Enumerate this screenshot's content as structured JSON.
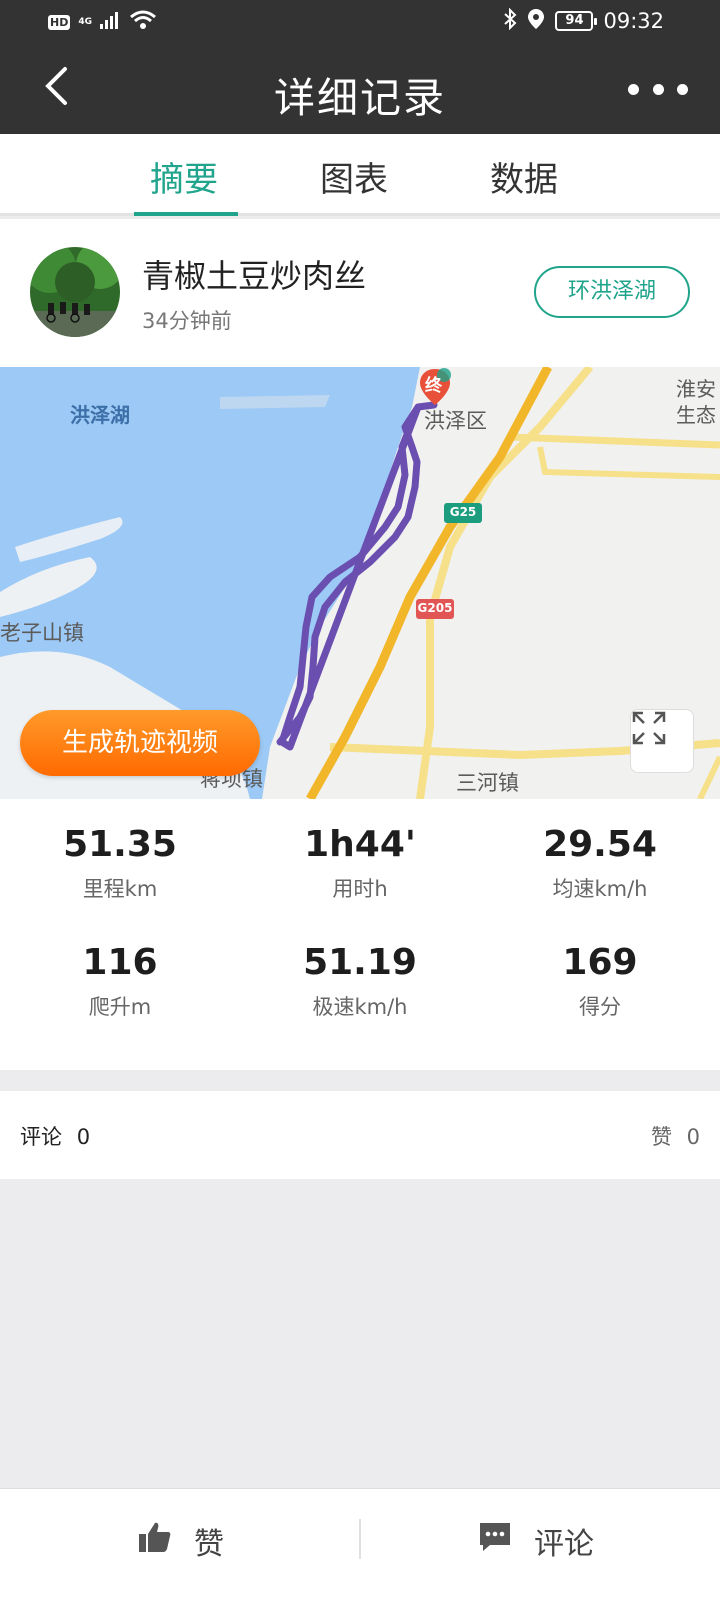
{
  "status_bar": {
    "hd": "HD",
    "network": "4G",
    "battery": "94",
    "time": "09:32"
  },
  "header": {
    "title": "详细记录"
  },
  "tabs": [
    {
      "label": "摘要",
      "active": true
    },
    {
      "label": "图表",
      "active": false
    },
    {
      "label": "数据",
      "active": false
    }
  ],
  "user": {
    "name": "青椒土豆炒肉丝",
    "time_ago": "34分钟前",
    "route_tag": "环洪泽湖"
  },
  "map": {
    "labels": {
      "lake": "洪泽湖",
      "district": "洪泽区",
      "town_left": "老子山镇",
      "town_bottom": "蒋坝镇",
      "town_bottom_right": "三河镇",
      "corner_1": "淮安",
      "corner_2": "生态"
    },
    "end_marker": "终",
    "roads": [
      "G25",
      "G205"
    ],
    "generate_video_label": "生成轨迹视频"
  },
  "stats": [
    {
      "value": "51.35",
      "label": "里程km"
    },
    {
      "value": "1h44'",
      "label": "用时h"
    },
    {
      "value": "29.54",
      "label": "均速km/h"
    },
    {
      "value": "116",
      "label": "爬升m"
    },
    {
      "value": "51.19",
      "label": "极速km/h"
    },
    {
      "value": "169",
      "label": "得分"
    }
  ],
  "comments": {
    "comment_label": "评论",
    "comment_count": "0",
    "like_label": "赞",
    "like_count": "0"
  },
  "bottom_bar": {
    "like_label": "赞",
    "comment_label": "评论"
  },
  "colors": {
    "accent": "#21a48c",
    "header_bg": "#333333",
    "route": "#6a4fb0",
    "cta_orange": "#ff7a0e"
  }
}
